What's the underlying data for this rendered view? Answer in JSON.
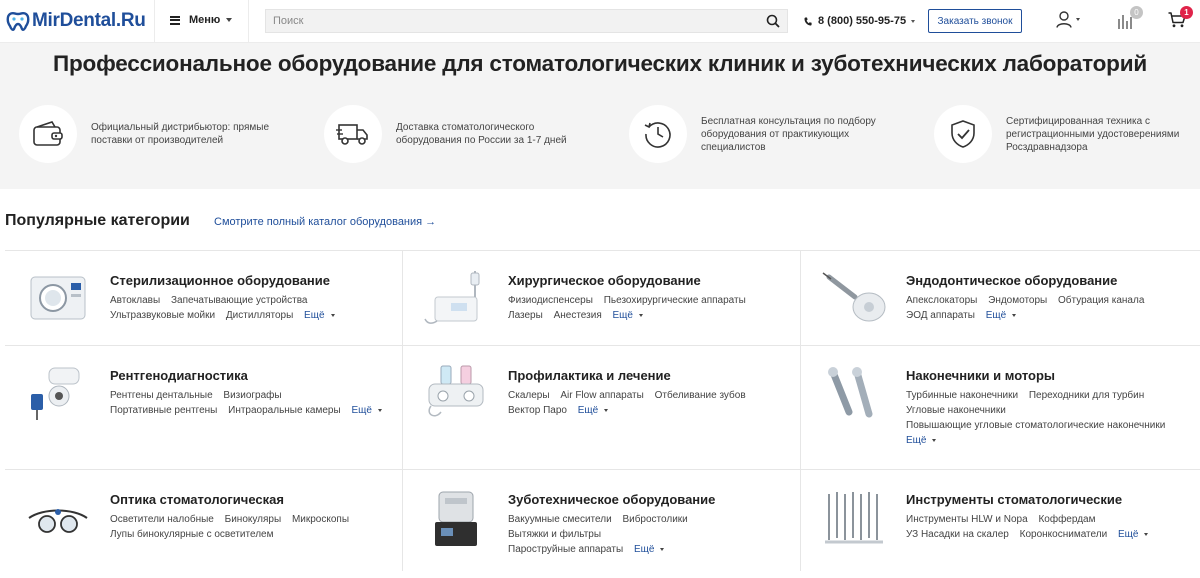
{
  "header": {
    "logo_text": "MirDental.Ru",
    "menu_label": "Меню",
    "search_placeholder": "Поиск",
    "phone": "8 (800) 550-95-75",
    "callback_label": "Заказать звонок",
    "compare_count": "0",
    "cart_count": "1"
  },
  "hero": {
    "title": "Профессиональное оборудование для стоматологических клиник и зуботехнических лабораторий",
    "features": [
      {
        "icon": "wallet-icon",
        "text": "Официальный дистрибьютор: прямые поставки от производителей"
      },
      {
        "icon": "truck-icon",
        "text": "Доставка стоматологического оборудования по России за 1-7 дней"
      },
      {
        "icon": "clock-icon",
        "text": "Бесплатная консультация по подбору оборудования от практикующих специалистов"
      },
      {
        "icon": "shield-check-icon",
        "text": "Сертифицированная техника с регистрационными удостоверениями Росздравнадзора"
      }
    ]
  },
  "categories": {
    "heading": "Популярные категории",
    "catalog_link": "Смотрите полный каталог оборудования →",
    "more_label": "Ещё",
    "items": [
      {
        "title": "Стерилизационное оборудование",
        "links": [
          "Автоклавы",
          "Запечатывающие устройства",
          "Ультразвуковые мойки",
          "Дистилляторы"
        ],
        "more": true
      },
      {
        "title": "Хирургическое оборудование",
        "links": [
          "Физиодиспенсеры",
          "Пьезохирургические аппараты",
          "Лазеры",
          "Анестезия"
        ],
        "more": true
      },
      {
        "title": "Эндодонтическое оборудование",
        "links": [
          "Апекслокаторы",
          "Эндомоторы",
          "Обтурация канала",
          "ЭОД аппараты"
        ],
        "more": true
      },
      {
        "title": "Рентгенодиагностика",
        "links": [
          "Рентгены дентальные",
          "Визиографы",
          "Портативные рентгены",
          "Интраоральные камеры"
        ],
        "more": true
      },
      {
        "title": "Профилактика и лечение",
        "links": [
          "Скалеры",
          "Air Flow аппараты",
          "Отбеливание зубов",
          "Вектор Паро"
        ],
        "more": true
      },
      {
        "title": "Наконечники и моторы",
        "links": [
          "Турбинные наконечники",
          "Переходники для турбин",
          "Угловые наконечники",
          "Повышающие угловые стоматологические наконечники"
        ],
        "more": true
      },
      {
        "title": "Оптика стоматологическая",
        "links": [
          "Осветители налобные",
          "Бинокуляры",
          "Микроскопы",
          "Лупы бинокулярные с осветителем"
        ],
        "more": false
      },
      {
        "title": "Зуботехническое оборудование",
        "links": [
          "Вакуумные смесители",
          "Вибростолики",
          "Вытяжки и фильтры",
          "Пароструйные аппараты"
        ],
        "more": true
      },
      {
        "title": "Инструменты стоматологические",
        "links": [
          "Инструменты HLW и Nopa",
          "Коффердам",
          "УЗ Насадки на скалер",
          "Коронкосниматели"
        ],
        "more": true
      }
    ]
  },
  "colors": {
    "brand": "#1f4e9a",
    "badge_red": "#e0244a",
    "hero_bg": "#f4f4f4"
  }
}
